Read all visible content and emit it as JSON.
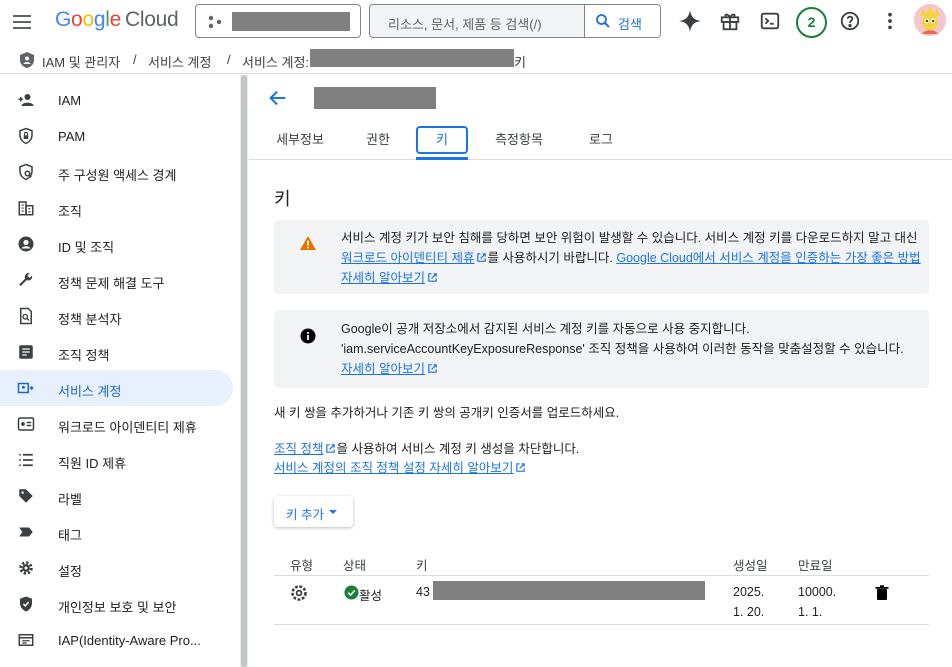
{
  "topbar": {
    "logo": {
      "g1": "G",
      "o1": "o",
      "o2": "o",
      "g2": "g",
      "l": "l",
      "e": "e",
      "cloud": "Cloud"
    },
    "search_placeholder": "리소스, 문서, 제품 등 검색(/)",
    "search_button": "검색",
    "notifications_count": "2",
    "icons": [
      "hamburger-icon",
      "project-dots-icon",
      "search-icon",
      "gemini-sparkle-icon",
      "gift-icon",
      "cloud-shell-icon",
      "help-icon",
      "more-vert-icon"
    ]
  },
  "breadcrumb": {
    "item1": "IAM 및 관리자",
    "sep": "/",
    "item2": "서비스 계정",
    "item3_prefix": "서비스 계정:",
    "item3_suffix": "키"
  },
  "sidebar": {
    "items": [
      {
        "label": "IAM",
        "icon": "person-add-icon"
      },
      {
        "label": "PAM",
        "icon": "shield-lock-icon"
      },
      {
        "label": "주 구성원 액세스 경계",
        "icon": "policy-boundary-icon"
      },
      {
        "label": "조직",
        "icon": "organization-icon"
      },
      {
        "label": "ID 및 조직",
        "icon": "account-circle-icon"
      },
      {
        "label": "정책 문제 해결 도구",
        "icon": "wrench-icon"
      },
      {
        "label": "정책 분석자",
        "icon": "policy-analyzer-icon"
      },
      {
        "label": "조직 정책",
        "icon": "article-icon"
      },
      {
        "label": "서비스 계정",
        "icon": "service-account-icon"
      },
      {
        "label": "워크로드 아이덴티티 제휴",
        "icon": "workload-identity-icon"
      },
      {
        "label": "직원 ID 제휴",
        "icon": "list-icon"
      },
      {
        "label": "라벨",
        "icon": "label-icon"
      },
      {
        "label": "태그",
        "icon": "tag-icon"
      },
      {
        "label": "설정",
        "icon": "settings-icon"
      },
      {
        "label": "개인정보 보호 및 보안",
        "icon": "privacy-shield-icon"
      },
      {
        "label": "IAP(Identity-Aware Pro...",
        "icon": "iap-icon"
      }
    ],
    "active_index": 8
  },
  "main": {
    "tabs": [
      "세부정보",
      "권한",
      "키",
      "측정항목",
      "로그"
    ],
    "active_tab": "키",
    "section_title": "키",
    "warning": {
      "line1": "서비스 계정 키가 보안 침해를 당하면 보안 위험이 발생할 수 있습니다. 서비스 계정 키를 다운로드하지 말고 대신",
      "link1": "워크로드 아이덴티티 제휴",
      "mid": "를 사용하시기 바랍니다.",
      "link2": "Google Cloud에서 서비스 계정을 인증하는 가장 좋은 방법",
      "link3": "자세히 알아보기"
    },
    "info": {
      "line1": "Google이 공개 저장소에서 감지된 서비스 계정 키를 자동으로 사용 중지합니다.",
      "line2": "'iam.serviceAccountKeyExposureResponse' 조직 정책을 사용하여 이러한 동작을 맞춤설정할 수 있습니다.",
      "link": "자세히 알아보기"
    },
    "para1": "새 키 쌍을 추가하거나 기존 키 쌍의 공개키 인증서를 업로드하세요.",
    "para2_link": "조직 정책",
    "para2_rest": "을 사용하여 서비스 계정 키 생성을 차단합니다.",
    "para3_link": "서비스 계정의 조직 정책 설정 자세히 알아보기",
    "add_key_button": "키 추가",
    "table": {
      "headers": {
        "type": "유형",
        "status": "상태",
        "key": "키",
        "created": "생성일",
        "expires": "만료일"
      },
      "rows": [
        {
          "status": "활성",
          "key_prefix": "43",
          "created_line1": "2025.",
          "created_line2": "1. 20.",
          "expires_line1": "10000.",
          "expires_line2": "1. 1."
        }
      ]
    }
  },
  "colors": {
    "accent": "#1a73e8",
    "active_bg": "#e8f0fe",
    "warning": "#e37400",
    "success": "#188038"
  }
}
